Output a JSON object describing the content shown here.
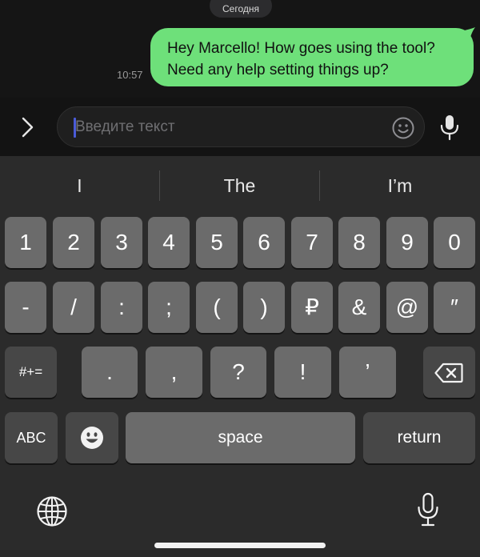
{
  "chat": {
    "date_label": "Сегодня",
    "message": {
      "text": "Hey Marcello! How goes using the tool? Need any help setting things up?",
      "time": "10:57"
    },
    "bubble_color": "#6ee07a"
  },
  "input": {
    "placeholder": "Введите текст",
    "icons": [
      "chevron-right-icon",
      "smiley-icon",
      "microphone-icon"
    ]
  },
  "keyboard": {
    "suggestions": [
      "I",
      "The",
      "I’m"
    ],
    "row1": [
      "1",
      "2",
      "3",
      "4",
      "5",
      "6",
      "7",
      "8",
      "9",
      "0"
    ],
    "row2": [
      "-",
      "/",
      ":",
      ";",
      "(",
      ")",
      "₽",
      "&",
      "@",
      "″"
    ],
    "row3": {
      "shift_label": "#+=",
      "keys": [
        ".",
        ",",
        "?",
        "!",
        "’"
      ],
      "backspace_icon": "backspace-icon"
    },
    "row4": {
      "abc_label": "ABC",
      "emoji_icon": "emoji-icon",
      "space_label": "space",
      "return_label": "return"
    },
    "bottom_icons": [
      "globe-icon",
      "microphone-icon"
    ]
  }
}
